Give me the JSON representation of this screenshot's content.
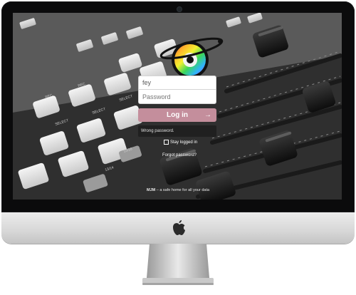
{
  "login": {
    "username_value": "fey",
    "password_placeholder": "Password",
    "button_label": "Log in",
    "button_arrow": "→",
    "warning": "Wrong password.",
    "stay_logged_in": "Stay logged in",
    "forgot_password": "Forgot password?"
  },
  "footer": {
    "brand": "MJM",
    "tagline": " – a safe home for all your data"
  },
  "colors": {
    "accent": "#c48e9c",
    "bezel": "#0b0b0c",
    "chin": "#d7d7d7"
  },
  "icons": {
    "logo": "rainbow-eye-orbit-icon",
    "apple": "apple-icon",
    "camera": "camera-icon",
    "arrow": "arrow-right-icon",
    "checkbox": "checkbox-icon"
  }
}
